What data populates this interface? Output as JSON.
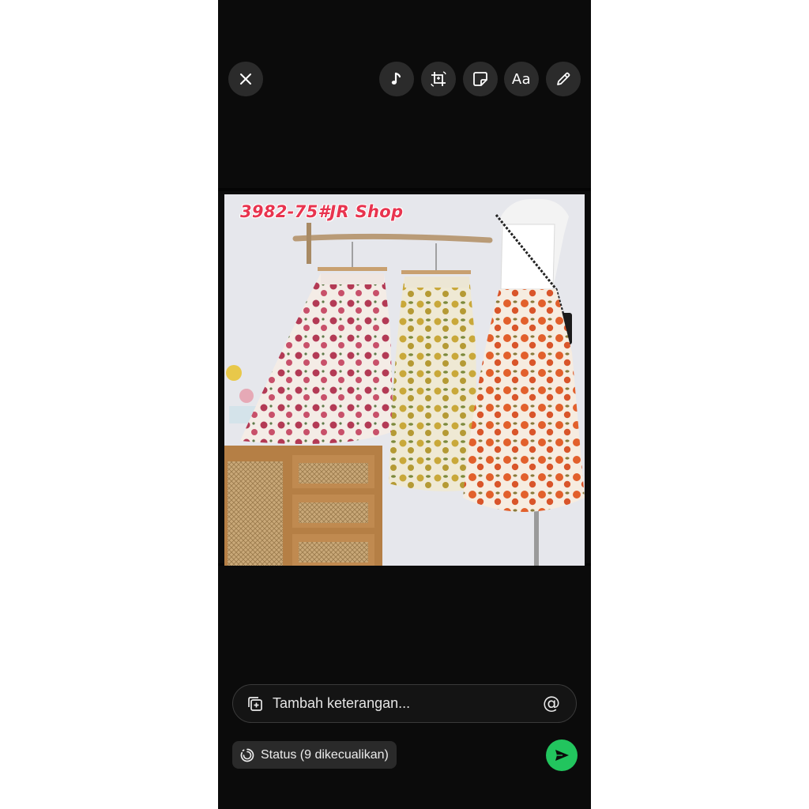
{
  "toolbar": {
    "close": "close-icon",
    "music": "music-note-icon",
    "crop": "crop-rotate-icon",
    "sticker": "sticker-icon",
    "text_label": "Aa",
    "draw": "pencil-icon"
  },
  "photo": {
    "overlay_text": "3982-75#JR Shop"
  },
  "caption": {
    "placeholder": "Tambah keterangan...",
    "add_icon": "add-media-icon",
    "mention_icon": "at-mention-icon",
    "mention_glyph": "@"
  },
  "status": {
    "label": "Status (9 dikecualikan)",
    "icon": "status-ring-icon"
  },
  "send": {
    "icon": "send-arrow-icon"
  },
  "colors": {
    "background": "#0b0b0b",
    "button_bg": "#2b2b2b",
    "send_green": "#22c55e",
    "overlay_red": "#e8344f"
  }
}
